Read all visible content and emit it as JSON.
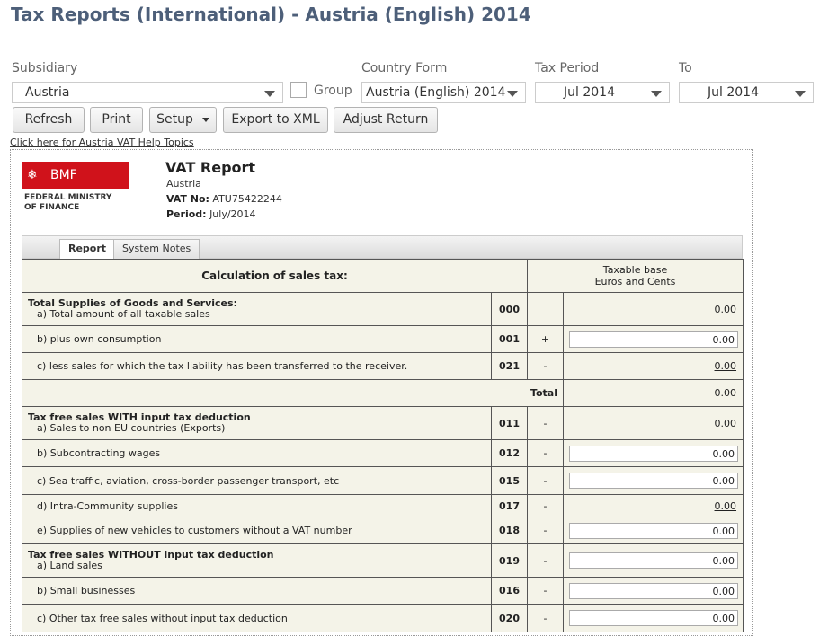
{
  "page_title": "Tax Reports (International) - Austria (English) 2014",
  "filters": {
    "subsidiary_label": "Subsidiary",
    "subsidiary_value": "Austria",
    "group_label": "Group",
    "country_form_label": "Country Form",
    "country_form_value": "Austria (English) 2014",
    "tax_period_label": "Tax Period",
    "tax_period_value": "Jul 2014",
    "to_label": "To",
    "to_value": "Jul 2014"
  },
  "toolbar": {
    "refresh": "Refresh",
    "print": "Print",
    "setup": "Setup",
    "export": "Export to XML",
    "adjust": "Adjust Return"
  },
  "help_link": "Click here for Austria VAT Help Topics",
  "report": {
    "logo_text": "BMF",
    "ministry_line1": "FEDERAL MINISTRY",
    "ministry_line2": "OF FINANCE",
    "title": "VAT Report",
    "country": "Austria",
    "vat_no_label": "VAT No:",
    "vat_no": "ATU75422244",
    "period_label": "Period:",
    "period": "July/2014"
  },
  "tabs": [
    {
      "label": "Report",
      "active": true
    },
    {
      "label": "System Notes",
      "active": false
    }
  ],
  "table": {
    "header_left": "Calculation of sales tax:",
    "header_right_line1": "Taxable base",
    "header_right_line2": "Euros and Cents",
    "total_label": "Total",
    "rows": [
      {
        "section": "Total Supplies of Goods and Services:",
        "label": "a) Total amount of all taxable sales",
        "code": "000",
        "sign": "",
        "value": "0.00",
        "type": "text"
      },
      {
        "section": "",
        "label": "b) plus own consumption",
        "code": "001",
        "sign": "+",
        "value": "0.00",
        "type": "input"
      },
      {
        "section": "",
        "label": "c) less sales for which the tax liability has been transferred to the receiver.",
        "code": "021",
        "sign": "-",
        "value": "0.00",
        "type": "link"
      },
      {
        "section": "",
        "label": "Total",
        "code": "",
        "sign": "",
        "value": "0.00",
        "type": "total"
      },
      {
        "section": "Tax free sales WITH input tax deduction",
        "label": "a) Sales to non EU countries (Exports)",
        "code": "011",
        "sign": "-",
        "value": "0.00",
        "type": "link"
      },
      {
        "section": "",
        "label": "b) Subcontracting wages",
        "code": "012",
        "sign": "-",
        "value": "0.00",
        "type": "input"
      },
      {
        "section": "",
        "label": "c) Sea traffic, aviation, cross-border passenger transport, etc",
        "code": "015",
        "sign": "-",
        "value": "0.00",
        "type": "input"
      },
      {
        "section": "",
        "label": "d) Intra-Community supplies",
        "code": "017",
        "sign": "-",
        "value": "0.00",
        "type": "link"
      },
      {
        "section": "",
        "label": "e) Supplies of new vehicles to customers without a VAT number",
        "code": "018",
        "sign": "-",
        "value": "0.00",
        "type": "input"
      },
      {
        "section": "Tax free sales WITHOUT input tax deduction",
        "label": "a) Land sales",
        "code": "019",
        "sign": "-",
        "value": "0.00",
        "type": "input"
      },
      {
        "section": "",
        "label": "b) Small businesses",
        "code": "016",
        "sign": "-",
        "value": "0.00",
        "type": "input"
      },
      {
        "section": "",
        "label": "c) Other tax free sales without input tax deduction",
        "code": "020",
        "sign": "-",
        "value": "0.00",
        "type": "input"
      }
    ]
  }
}
